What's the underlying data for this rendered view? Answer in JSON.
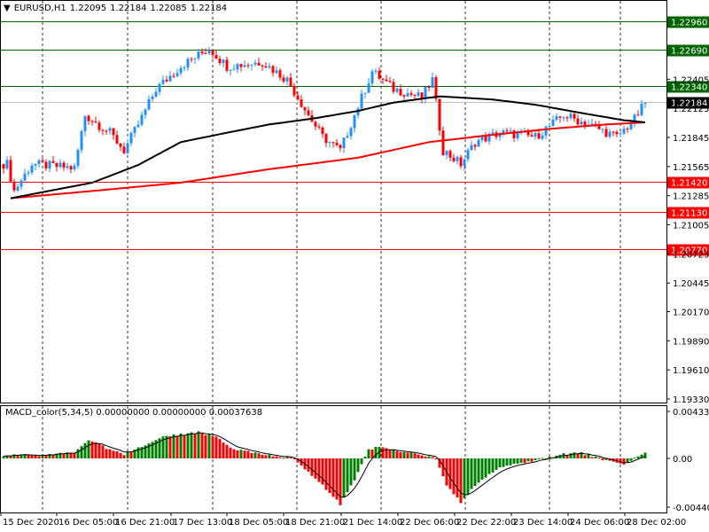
{
  "header": {
    "symbol": "EURUSD,H1",
    "open": "1.22095",
    "high": "1.22184",
    "low": "1.22085",
    "close": "1.22184"
  },
  "macd_label": {
    "name": "MACD_color(5,34,5)",
    "v1": "0.00000000",
    "v2": "0.00000000",
    "v3": "0.00037638"
  },
  "colors": {
    "bull": "#1e90ff",
    "bear": "#ff0000",
    "ma_fast": "#000000",
    "ma_slow": "#ff0000",
    "resistance": "#006400",
    "support": "#ff0000",
    "hist_up": "#008000",
    "hist_down": "#ff0000"
  },
  "chart_data": {
    "type": "candlestick",
    "symbol": "EURUSD",
    "timeframe": "H1",
    "ylim": [
      1.1933,
      1.231
    ],
    "price_ticks": [
      "1.22405",
      "1.22125",
      "1.21845",
      "1.21565",
      "1.21285",
      "1.21005",
      "1.20725",
      "1.20445",
      "1.20170",
      "1.19890",
      "1.19610",
      "1.19330"
    ],
    "time_labels": [
      "15 Dec 2020",
      "16 Dec 05:00",
      "16 Dec 21:00",
      "17 Dec 13:00",
      "18 Dec 05:00",
      "18 Dec 21:00",
      "21 Dec 14:00",
      "22 Dec 06:00",
      "22 Dec 22:00",
      "23 Dec 14:00",
      "24 Dec 06:00",
      "28 Dec 02:00"
    ],
    "bar_count": 182,
    "close_path": [
      [
        1,
        1.2159
      ],
      [
        3,
        1.2133
      ],
      [
        8,
        1.2159
      ],
      [
        20,
        1.2155
      ],
      [
        23,
        1.2206
      ],
      [
        30,
        1.2189
      ],
      [
        34,
        1.2172
      ],
      [
        38,
        1.2197
      ],
      [
        43,
        1.2231
      ],
      [
        50,
        1.2253
      ],
      [
        58,
        1.227
      ],
      [
        63,
        1.2253
      ],
      [
        73,
        1.2257
      ],
      [
        80,
        1.224
      ],
      [
        86,
        1.2206
      ],
      [
        90,
        1.2185
      ],
      [
        95,
        1.2172
      ],
      [
        99,
        1.2206
      ],
      [
        104,
        1.2248
      ],
      [
        110,
        1.2231
      ],
      [
        118,
        1.2223
      ],
      [
        121,
        1.224
      ],
      [
        124,
        1.2172
      ],
      [
        129,
        1.2159
      ],
      [
        133,
        1.218
      ],
      [
        140,
        1.2189
      ],
      [
        150,
        1.2185
      ],
      [
        158,
        1.2206
      ],
      [
        165,
        1.2197
      ],
      [
        173,
        1.2185
      ],
      [
        178,
        1.2202
      ],
      [
        181,
        1.2218
      ]
    ],
    "ma_fast": [
      [
        2,
        1.2126
      ],
      [
        25,
        1.2141
      ],
      [
        38,
        1.2158
      ],
      [
        50,
        1.218
      ],
      [
        63,
        1.2189
      ],
      [
        75,
        1.2197
      ],
      [
        88,
        1.2203
      ],
      [
        100,
        1.221
      ],
      [
        110,
        1.2218
      ],
      [
        123,
        1.2224
      ],
      [
        138,
        1.2221
      ],
      [
        150,
        1.2216
      ],
      [
        163,
        1.2208
      ],
      [
        175,
        1.2201
      ],
      [
        181,
        1.2199
      ]
    ],
    "ma_slow": [
      [
        2,
        1.2126
      ],
      [
        25,
        1.2133
      ],
      [
        50,
        1.2141
      ],
      [
        75,
        1.2154
      ],
      [
        100,
        1.2165
      ],
      [
        120,
        1.218
      ],
      [
        138,
        1.2187
      ],
      [
        155,
        1.2193
      ],
      [
        170,
        1.2197
      ],
      [
        181,
        1.2199
      ]
    ],
    "levels": [
      {
        "price": "1.22960",
        "kind": "resistance"
      },
      {
        "price": "1.22690",
        "kind": "resistance"
      },
      {
        "price": "1.22340",
        "kind": "resistance"
      },
      {
        "price": "1.21420",
        "kind": "support"
      },
      {
        "price": "1.21130",
        "kind": "support"
      },
      {
        "price": "1.20770",
        "kind": "support"
      }
    ],
    "current_price": "1.22184",
    "macd": {
      "ylim": [
        -0.004406,
        0.0043319
      ],
      "ticks": [
        "0.0043319",
        "0.00",
        "-0.004406"
      ],
      "hist_path": [
        [
          0,
          0.0003
        ],
        [
          10,
          0.0003
        ],
        [
          20,
          0.0005
        ],
        [
          24,
          0.0017
        ],
        [
          30,
          0.0008
        ],
        [
          34,
          0.0004
        ],
        [
          38,
          0.001
        ],
        [
          45,
          0.002
        ],
        [
          55,
          0.0024
        ],
        [
          60,
          0.002
        ],
        [
          65,
          0.0008
        ],
        [
          75,
          0.0003
        ],
        [
          82,
          0.0
        ],
        [
          85,
          -0.001
        ],
        [
          90,
          -0.0025
        ],
        [
          95,
          -0.0042
        ],
        [
          99,
          -0.002
        ],
        [
          103,
          0.0008
        ],
        [
          106,
          0.0011
        ],
        [
          113,
          0.0006
        ],
        [
          120,
          0.0002
        ],
        [
          122,
          -0.0001
        ],
        [
          125,
          -0.0025
        ],
        [
          129,
          -0.004
        ],
        [
          133,
          -0.0025
        ],
        [
          140,
          -0.0008
        ],
        [
          150,
          -0.0002
        ],
        [
          158,
          0.0004
        ],
        [
          163,
          0.0005
        ],
        [
          170,
          -0.0002
        ],
        [
          175,
          -0.0005
        ],
        [
          179,
          0.0002
        ],
        [
          181,
          0.0005
        ]
      ]
    }
  }
}
